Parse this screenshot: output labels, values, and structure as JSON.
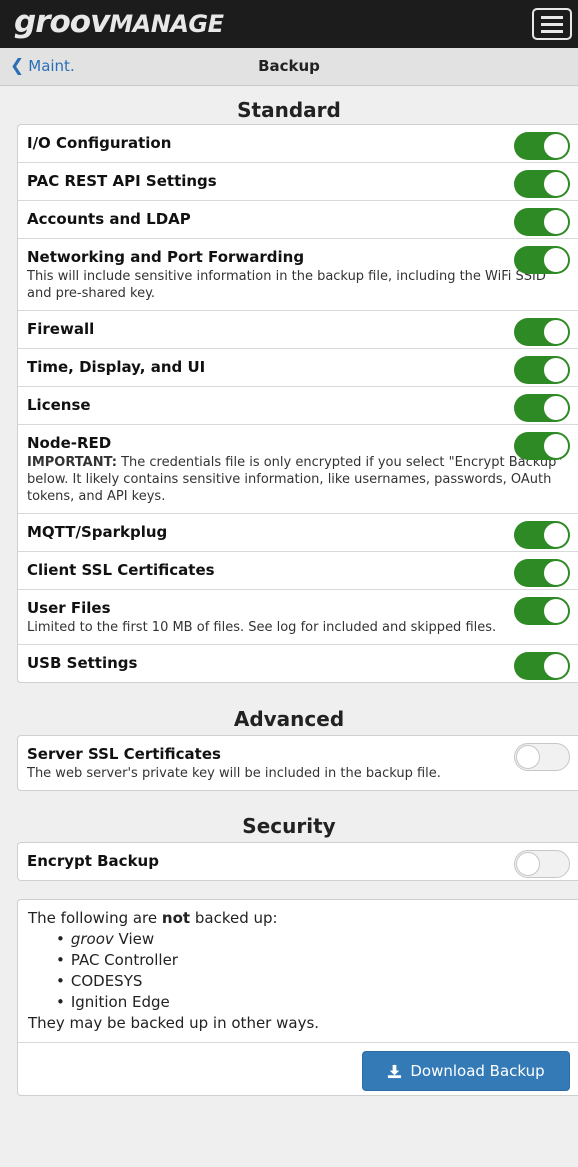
{
  "header": {
    "logo_part1": "groov",
    "logo_part2": "MANAGE",
    "menu_icon": "hamburger-menu-icon"
  },
  "nav": {
    "back_label": "Maint.",
    "title": "Backup"
  },
  "sections": {
    "standard": "Standard",
    "advanced": "Advanced",
    "security": "Security"
  },
  "standard_items": [
    {
      "label": "I/O Configuration",
      "on": true
    },
    {
      "label": "PAC REST API Settings",
      "on": true
    },
    {
      "label": "Accounts and LDAP",
      "on": true
    },
    {
      "label": "Networking and Port Forwarding",
      "on": true,
      "desc": "This will include sensitive information in the backup file, including the WiFi SSID and pre-shared key."
    },
    {
      "label": "Firewall",
      "on": true
    },
    {
      "label": "Time, Display, and UI",
      "on": true
    },
    {
      "label": "License",
      "on": true
    },
    {
      "label": "Node-RED",
      "on": true,
      "desc_bold": "IMPORTANT:",
      "desc": "The credentials file is only encrypted if you select \"Encrypt Backup\" below. It likely contains sensitive information, like usernames, passwords, OAuth tokens, and API keys."
    },
    {
      "label": "MQTT/Sparkplug",
      "on": true
    },
    {
      "label": "Client SSL Certificates",
      "on": true
    },
    {
      "label": "User Files",
      "on": true,
      "desc": "Limited to the first 10 MB of files. See log for included and skipped files."
    },
    {
      "label": "USB Settings",
      "on": true
    }
  ],
  "advanced_items": [
    {
      "label": "Server SSL Certificates",
      "on": false,
      "desc": "The web server's private key will be included in the backup file."
    }
  ],
  "security_items": [
    {
      "label": "Encrypt Backup",
      "on": false
    }
  ],
  "notes": {
    "intro_pre": "The following are",
    "intro_bold": "not",
    "intro_post": "backed up:",
    "items": [
      {
        "italic": "groov",
        "text": " View"
      },
      {
        "italic": "",
        "text": "PAC Controller"
      },
      {
        "italic": "",
        "text": "CODESYS"
      },
      {
        "italic": "",
        "text": "Ignition Edge"
      }
    ],
    "outro": "They may be backed up in other ways."
  },
  "download_button": {
    "label": "Download Backup",
    "icon": "download-icon"
  },
  "colors": {
    "toggle_on": "#2e8a24",
    "button": "#337ab7",
    "link": "#2a6fb6",
    "topbar": "#1c1c1c"
  }
}
